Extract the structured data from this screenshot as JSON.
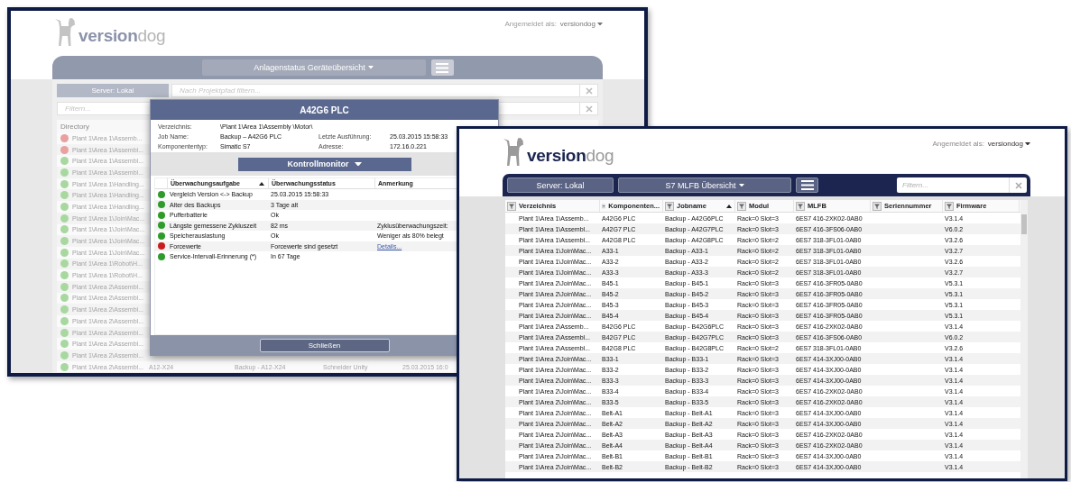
{
  "left_window": {
    "logo": "**version**dog",
    "user": {
      "label": "Angemeldet als:",
      "name": "versiondog"
    },
    "view_menu": "Anlagenstatus Geräteübersicht",
    "server": "Server: Lokal",
    "path_filter": {
      "placeholder": "Nach Projektpfad filtern..."
    },
    "filter": {
      "placeholder": "Filtern..."
    },
    "table": {
      "column": "Directory",
      "rows": [
        {
          "color": "#e8a0a0",
          "path": "Plant 1\\Area 1\\Assemb..."
        },
        {
          "color": "#e8a0a0",
          "path": "Plant 1\\Area 1\\Assembl..."
        },
        {
          "color": "#a8d8a0",
          "path": "Plant 1\\Area 1\\Assembl..."
        },
        {
          "color": "#a8d8a0",
          "path": "Plant 1\\Area 1\\Assembl..."
        },
        {
          "color": "#a8d8a0",
          "path": "Plant 1\\Area 1\\Handling..."
        },
        {
          "color": "#a8d8a0",
          "path": "Plant 1\\Area 1\\Handling..."
        },
        {
          "color": "#a8d8a0",
          "path": "Plant 1\\Area 1\\Handling..."
        },
        {
          "color": "#a8d8a0",
          "path": "Plant 1\\Area 1\\Join\\Mac..."
        },
        {
          "color": "#a8d8a0",
          "path": "Plant 1\\Area 1\\Join\\Mac..."
        },
        {
          "color": "#a8d8a0",
          "path": "Plant 1\\Area 1\\Join\\Mac..."
        },
        {
          "color": "#a8d8a0",
          "path": "Plant 1\\Area 1\\Join\\Mac..."
        },
        {
          "color": "#a8d8a0",
          "path": "Plant 1\\Area 1\\Robot\\H..."
        },
        {
          "color": "#a8d8a0",
          "path": "Plant 1\\Area 1\\Robot\\H..."
        },
        {
          "color": "#a8d8a0",
          "path": "Plant 1\\Area 2\\Assembl..."
        },
        {
          "color": "#a8d8a0",
          "path": "Plant 1\\Area 2\\Assembl..."
        },
        {
          "color": "#a8d8a0",
          "path": "Plant 1\\Area 2\\Assembl..."
        },
        {
          "color": "#a8d8a0",
          "path": "Plant 1\\Area 2\\Assembl..."
        },
        {
          "color": "#a8d8a0",
          "path": "Plant 1\\Area 2\\Assembl..."
        },
        {
          "color": "#a8d8a0",
          "path": "Plant 1\\Area 2\\Assembl..."
        },
        {
          "color": "#a8d8a0",
          "path": "Plant 1\\Area 2\\Assembl..."
        },
        {
          "color": "#a8d8a0",
          "path": "Plant 1\\Area 2\\Assembl...",
          "cells": [
            "A12-X24",
            "Backup - A12-X24",
            "Schneider Unity",
            "25.03.2015 16:0"
          ]
        }
      ]
    },
    "dialog": {
      "title": "A42G6 PLC",
      "info_rows": [
        [
          {
            "label": "Verzeichnis:",
            "value": "\\Plant 1\\Area 1\\Assembly \\Motor\\"
          }
        ],
        [
          {
            "label": "Job Name:",
            "value": "Backup – A42G6 PLC"
          },
          {
            "label": "Letzte Ausführung:",
            "value": "25.03.2015 15:58:33"
          }
        ],
        [
          {
            "label": "Komponententyp:",
            "value": "Simatic S7"
          },
          {
            "label": "Adresse:",
            "value": "172.16.0.221"
          }
        ]
      ],
      "monitor_button": "Kontrollmonitor",
      "columns": [
        {
          "label": "Überwachungsaufgabe",
          "sorted": true
        },
        {
          "label": "Überwachungsstatus",
          "sorted": false
        },
        {
          "label": "Anmerkung",
          "sorted": false
        }
      ],
      "rows": [
        {
          "color": "#2f9b2a",
          "task": "Vergleich Version <-> Backup",
          "state": "25.03.2015 15:58:33"
        },
        {
          "color": "#2f9b2a",
          "task": "Alter des Backups",
          "state": "3 Tage alt"
        },
        {
          "color": "#2f9b2a",
          "task": "Pufferbatterie",
          "state": "Ok"
        },
        {
          "color": "#2f9b2a",
          "task": "Längste gemessene Zykluszeit",
          "state": "82 ms",
          "note": "Zyklusüberwachungszeit:"
        },
        {
          "color": "#2f9b2a",
          "task": "Speicherauslastung",
          "state": "Ok",
          "note": "Weniger als 80% belegt"
        },
        {
          "color": "#c81e1e",
          "task": "Forcewerte",
          "state": "Forcewerte sind gesetzt",
          "link": "Details..."
        },
        {
          "color": "#2f9b2a",
          "task": "Service-Intervall-Erinnerung (*)",
          "state": "In 67 Tage"
        }
      ],
      "close_button": "Schließen"
    }
  },
  "right_window": {
    "logo": "**version**dog",
    "user": {
      "label": "Angemeldet als:",
      "name": "versiondog"
    },
    "server": "Server: Lokal",
    "view_menu": "S7 MLFB Übersicht",
    "filter": {
      "placeholder": "Filtern..."
    },
    "columns": [
      {
        "label": "Verzeichnis",
        "sorted": false
      },
      {
        "label": "Komponenten...",
        "sorted": false
      },
      {
        "label": "Jobname",
        "sorted": true
      },
      {
        "label": "Modul",
        "sorted": false
      },
      {
        "label": "MLFB",
        "sorted": false
      },
      {
        "label": "Seriennummer",
        "sorted": false
      },
      {
        "label": "Firmware",
        "sorted": false
      }
    ],
    "rows": [
      {
        "verzeichnis": "Plant 1\\Area 1\\Assemb...",
        "komponente": "A42G6 PLC",
        "jobname": "Backup - A42G6PLC",
        "modul": "Rack=0 Slot=3",
        "mlfb": "6ES7 416-2XK02-0AB0",
        "firmware": "V3.1.4"
      },
      {
        "verzeichnis": "Plant 1\\Area 1\\Assembl...",
        "komponente": "A42G7 PLC",
        "jobname": "Backup - A42G7PLC",
        "modul": "Rack=0 Slot=3",
        "mlfb": "6ES7 416-3FS06-0AB0",
        "firmware": "V6.0.2"
      },
      {
        "verzeichnis": "Plant 1\\Area 1\\Assembl...",
        "komponente": "A42G8 PLC",
        "jobname": "Backup - A42G8PLC",
        "modul": "Rack=0 Slot=2",
        "mlfb": "6ES7 318-3FL01-0AB0",
        "firmware": "V3.2.6"
      },
      {
        "verzeichnis": "Plant 1\\Area 1\\Join\\Mac...",
        "komponente": "A33-1",
        "jobname": "Backup - A33-1",
        "modul": "Rack=0 Slot=2",
        "mlfb": "6ES7 318-3FL01-0AB0",
        "firmware": "V3.2.7"
      },
      {
        "verzeichnis": "Plant 1\\Area 1\\Join\\Mac...",
        "komponente": "A33-2",
        "jobname": "Backup - A33-2",
        "modul": "Rack=0 Slot=2",
        "mlfb": "6ES7 318-3FL01-0AB0",
        "firmware": "V3.2.6"
      },
      {
        "verzeichnis": "Plant 1\\Area 1\\Join\\Mac...",
        "komponente": "A33-3",
        "jobname": "Backup - A33-3",
        "modul": "Rack=0 Slot=2",
        "mlfb": "6ES7 318-3FL01-0AB0",
        "firmware": "V3.2.7"
      },
      {
        "verzeichnis": "Plant 1\\Area 2\\Join\\Mac...",
        "komponente": "B45-1",
        "jobname": "Backup - B45-1",
        "modul": "Rack=0 Slot=3",
        "mlfb": "6ES7 416-3FR05-0AB0",
        "firmware": "V5.3.1"
      },
      {
        "verzeichnis": "Plant 1\\Area 2\\Join\\Mac...",
        "komponente": "B45-2",
        "jobname": "Backup - B45-2",
        "modul": "Rack=0 Slot=3",
        "mlfb": "6ES7 416-3FR05-0AB0",
        "firmware": "V5.3.1"
      },
      {
        "verzeichnis": "Plant 1\\Area 2\\Join\\Mac...",
        "komponente": "B45-3",
        "jobname": "Backup - B45-3",
        "modul": "Rack=0 Slot=3",
        "mlfb": "6ES7 416-3FR05-0AB0",
        "firmware": "V5.3.1"
      },
      {
        "verzeichnis": "Plant 1\\Area 2\\Join\\Mac...",
        "komponente": "B45-4",
        "jobname": "Backup - B45-4",
        "modul": "Rack=0 Slot=3",
        "mlfb": "6ES7 416-3FR05-0AB0",
        "firmware": "V5.3.1"
      },
      {
        "verzeichnis": "Plant 1\\Area 2\\Assemb...",
        "komponente": "B42G6 PLC",
        "jobname": "Backup - B42G6PLC",
        "modul": "Rack=0 Slot=3",
        "mlfb": "6ES7 416-2XK02-0AB0",
        "firmware": "V3.1.4"
      },
      {
        "verzeichnis": "Plant 1\\Area 2\\Assembl...",
        "komponente": "B42G7 PLC",
        "jobname": "Backup - B42G7PLC",
        "modul": "Rack=0 Slot=3",
        "mlfb": "6ES7 416-3FS06-0AB0",
        "firmware": "V6.0.2"
      },
      {
        "verzeichnis": "Plant 1\\Area 2\\Assembl...",
        "komponente": "B42G8 PLC",
        "jobname": "Backup - B42G8PLC",
        "modul": "Rack=0 Slot=2",
        "mlfb": "6ES7 318-3FL01-0AB0",
        "firmware": "V3.2.6"
      },
      {
        "verzeichnis": "Plant 1\\Area 2\\Join\\Mac...",
        "komponente": "B33-1",
        "jobname": "Backup - B33-1",
        "modul": "Rack=0 Slot=3",
        "mlfb": "6ES7 414-3XJ00-0AB0",
        "firmware": "V3.1.4"
      },
      {
        "verzeichnis": "Plant 1\\Area 2\\Join\\Mac...",
        "komponente": "B33-2",
        "jobname": "Backup - B33-2",
        "modul": "Rack=0 Slot=3",
        "mlfb": "6ES7 414-3XJ00-0AB0",
        "firmware": "V3.1.4"
      },
      {
        "verzeichnis": "Plant 1\\Area 2\\Join\\Mac...",
        "komponente": "B33-3",
        "jobname": "Backup - B33-3",
        "modul": "Rack=0 Slot=3",
        "mlfb": "6ES7 414-3XJ00-0AB0",
        "firmware": "V3.1.4"
      },
      {
        "verzeichnis": "Plant 1\\Area 2\\Join\\Mac...",
        "komponente": "B33-4",
        "jobname": "Backup - B33-4",
        "modul": "Rack=0 Slot=3",
        "mlfb": "6ES7 416-2XK02-0AB0",
        "firmware": "V3.1.4"
      },
      {
        "verzeichnis": "Plant 1\\Area 2\\Join\\Mac...",
        "komponente": "B33-5",
        "jobname": "Backup - B33-5",
        "modul": "Rack=0 Slot=3",
        "mlfb": "6ES7 416-2XK02-0AB0",
        "firmware": "V3.1.4"
      },
      {
        "verzeichnis": "Plant 1\\Area 2\\Join\\Mac...",
        "komponente": "Belt-A1",
        "jobname": "Backup - Belt-A1",
        "modul": "Rack=0 Slot=3",
        "mlfb": "6ES7 414-3XJ00-0AB0",
        "firmware": "V3.1.4"
      },
      {
        "verzeichnis": "Plant 1\\Area 2\\Join\\Mac...",
        "komponente": "Belt-A2",
        "jobname": "Backup - Belt-A2",
        "modul": "Rack=0 Slot=3",
        "mlfb": "6ES7 414-3XJ00-0AB0",
        "firmware": "V3.1.4"
      },
      {
        "verzeichnis": "Plant 1\\Area 2\\Join\\Mac...",
        "komponente": "Belt-A3",
        "jobname": "Backup - Belt-A3",
        "modul": "Rack=0 Slot=3",
        "mlfb": "6ES7 416-2XK02-0AB0",
        "firmware": "V3.1.4"
      },
      {
        "verzeichnis": "Plant 1\\Area 2\\Join\\Mac...",
        "komponente": "Belt-A4",
        "jobname": "Backup - Belt-A4",
        "modul": "Rack=0 Slot=3",
        "mlfb": "6ES7 416-2XK02-0AB0",
        "firmware": "V3.1.4"
      },
      {
        "verzeichnis": "Plant 1\\Area 2\\Join\\Mac...",
        "komponente": "Belt-B1",
        "jobname": "Backup - Belt-B1",
        "modul": "Rack=0 Slot=3",
        "mlfb": "6ES7 414-3XJ00-0AB0",
        "firmware": "V3.1.4"
      },
      {
        "verzeichnis": "Plant 1\\Area 2\\Join\\Mac...",
        "komponente": "Belt-B2",
        "jobname": "Backup - Belt-B2",
        "modul": "Rack=0 Slot=3",
        "mlfb": "6ES7 414-3XJ00-0AB0",
        "firmware": "V3.1.4"
      }
    ]
  }
}
